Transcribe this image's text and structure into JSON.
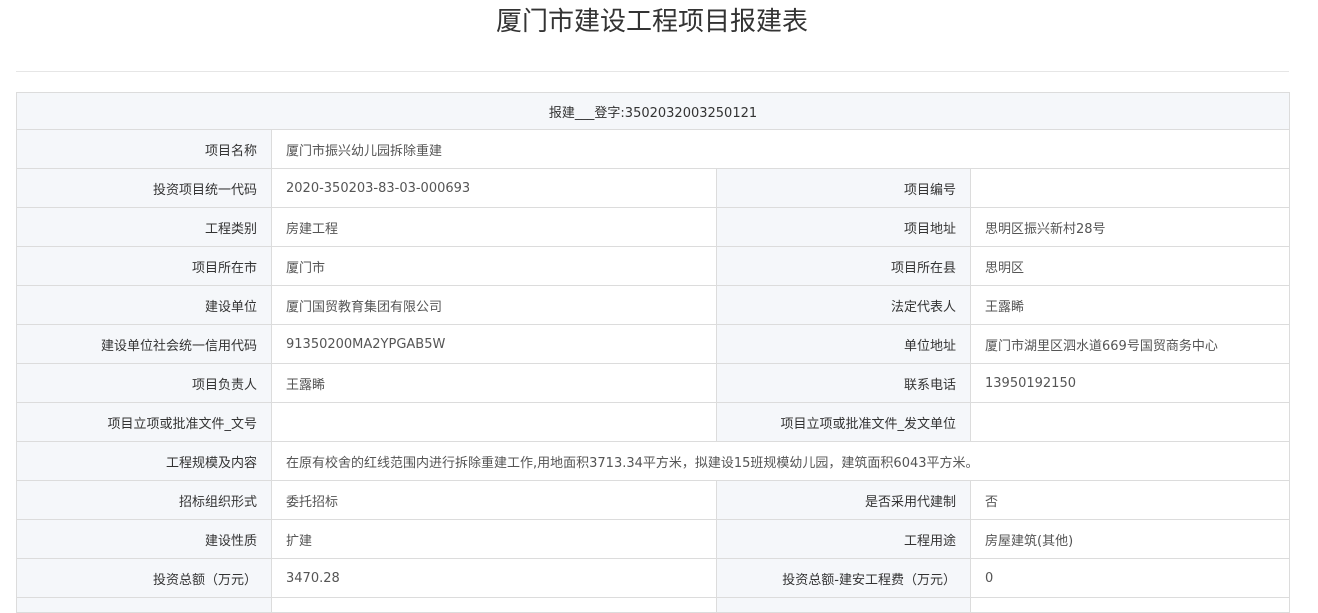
{
  "page_title": "厦门市建设工程项目报建表",
  "registration": {
    "label": "报建___登字:",
    "number": "3502032003250121"
  },
  "fields": {
    "project_name": {
      "label": "项目名称",
      "value": "厦门市振兴幼儿园拆除重建"
    },
    "investment_code": {
      "label": "投资项目统一代码",
      "value": "2020-350203-83-03-000693"
    },
    "project_number": {
      "label": "项目编号",
      "value": ""
    },
    "project_type": {
      "label": "工程类别",
      "value": "房建工程"
    },
    "project_address": {
      "label": "项目地址",
      "value": "思明区振兴新村28号"
    },
    "city": {
      "label": "项目所在市",
      "value": "厦门市"
    },
    "county": {
      "label": "项目所在县",
      "value": "思明区"
    },
    "builder": {
      "label": "建设单位",
      "value": "厦门国贸教育集团有限公司"
    },
    "legal_rep": {
      "label": "法定代表人",
      "value": "王露睎"
    },
    "credit_code": {
      "label": "建设单位社会统一信用代码",
      "value": "91350200MA2YPGAB5W"
    },
    "unit_address": {
      "label": "单位地址",
      "value": "厦门市湖里区泗水道669号国贸商务中心"
    },
    "project_manager": {
      "label": "项目负责人",
      "value": "王露睎"
    },
    "phone": {
      "label": "联系电话",
      "value": "13950192150"
    },
    "approval_doc_no": {
      "label": "项目立项或批准文件_文号",
      "value": ""
    },
    "approval_issuer": {
      "label": "项目立项或批准文件_发文单位",
      "value": ""
    },
    "scale_content": {
      "label": "工程规模及内容",
      "value": "在原有校舍的红线范围内进行拆除重建工作,用地面积3713.34平方米，拟建设15班规模幼儿园，建筑面积6043平方米。"
    },
    "tender_form": {
      "label": "招标组织形式",
      "value": "委托招标"
    },
    "agent_construction": {
      "label": "是否采用代建制",
      "value": "否"
    },
    "construction_nature": {
      "label": "建设性质",
      "value": "扩建"
    },
    "project_use": {
      "label": "工程用途",
      "value": "房屋建筑(其他)"
    },
    "total_investment": {
      "label": "投资总额（万元）",
      "value": "3470.28"
    },
    "construction_cost": {
      "label": "投资总额-建安工程费（万元）",
      "value": "0"
    }
  }
}
